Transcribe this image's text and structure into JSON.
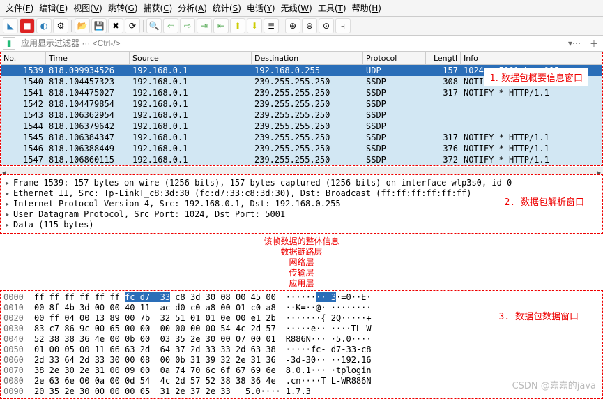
{
  "menubar": [
    "文件(F)",
    "编辑(E)",
    "视图(V)",
    "跳转(G)",
    "捕获(C)",
    "分析(A)",
    "统计(S)",
    "电话(Y)",
    "无线(W)",
    "工具(T)",
    "帮助(H)"
  ],
  "filter": {
    "placeholder": "应用显示过滤器 ··· <Ctrl-/>"
  },
  "columns": {
    "no": "No.",
    "time": "Time",
    "src": "Source",
    "dst": "Destination",
    "proto": "Protocol",
    "len": "Lengtl",
    "info": "Info"
  },
  "packets": [
    {
      "no": "1539",
      "time": "818.099934526",
      "src": "192.168.0.1",
      "dst": "192.168.0.255",
      "proto": "UDP",
      "len": "157",
      "info": "1024 → 5001 Len=115",
      "sel": true
    },
    {
      "no": "1540",
      "time": "818.104457323",
      "src": "192.168.0.1",
      "dst": "239.255.255.250",
      "proto": "SSDP",
      "len": "308",
      "info": "NOTIFY * HTTP/1.1"
    },
    {
      "no": "1541",
      "time": "818.104475027",
      "src": "192.168.0.1",
      "dst": "239.255.255.250",
      "proto": "SSDP",
      "len": "317",
      "info": "NOTIFY * HTTP/1.1"
    },
    {
      "no": "1542",
      "time": "818.104479854",
      "src": "192.168.0.1",
      "dst": "239.255.255.250",
      "proto": "SSDP",
      "len": "",
      "info": ""
    },
    {
      "no": "1543",
      "time": "818.106362954",
      "src": "192.168.0.1",
      "dst": "239.255.255.250",
      "proto": "SSDP",
      "len": "",
      "info": ""
    },
    {
      "no": "1544",
      "time": "818.106379642",
      "src": "192.168.0.1",
      "dst": "239.255.255.250",
      "proto": "SSDP",
      "len": "",
      "info": ""
    },
    {
      "no": "1545",
      "time": "818.106384347",
      "src": "192.168.0.1",
      "dst": "239.255.255.250",
      "proto": "SSDP",
      "len": "317",
      "info": "NOTIFY * HTTP/1.1"
    },
    {
      "no": "1546",
      "time": "818.106388449",
      "src": "192.168.0.1",
      "dst": "239.255.255.250",
      "proto": "SSDP",
      "len": "376",
      "info": "NOTIFY * HTTP/1.1"
    },
    {
      "no": "1547",
      "time": "818.106860115",
      "src": "192.168.0.1",
      "dst": "239.255.255.250",
      "proto": "SSDP",
      "len": "372",
      "info": "NOTIFY * HTTP/1.1"
    }
  ],
  "annos": {
    "a1": "1. 数据包概要信息窗口",
    "a2": "2. 数据包解析窗口",
    "a3": "3. 数据包数据窗口"
  },
  "details": [
    "Frame 1539: 157 bytes on wire (1256 bits), 157 bytes captured (1256 bits) on interface wlp3s0, id 0",
    "Ethernet II, Src: Tp-LinkT_c8:3d:30 (fc:d7:33:c8:3d:30), Dst: Broadcast (ff:ff:ff:ff:ff:ff)",
    "Internet Protocol Version 4, Src: 192.168.0.1, Dst: 192.168.0.255",
    "User Datagram Protocol, Src Port: 1024, Dst Port: 5001",
    "Data (115 bytes)"
  ],
  "layers": [
    "该帧数据的整体信息",
    "数据链路层",
    "网络层",
    "传输层",
    "应用层"
  ],
  "hex": [
    {
      "off": "0000",
      "h1": "ff ff ff ff ff ff ",
      "hl": "fc d7  33",
      "h2": " c8 3d 30 08 00 45 00",
      "a1": "······",
      "al": "·· 3",
      "a2": "·=0··E·"
    },
    {
      "off": "0010",
      "h1": "00 8f 4b 3d 00 00 40 11  ac d0 c0 a8 00 01 c0 a8",
      "a1": "··K=··@· ········"
    },
    {
      "off": "0020",
      "h1": "00 ff 04 00 13 89 00 7b  32 51 01 01 0e 00 e1 2b",
      "a1": "·······{ 2Q·····+"
    },
    {
      "off": "0030",
      "h1": "83 c7 86 9c 00 65 00 00  00 00 00 00 54 4c 2d 57",
      "a1": "·····e·· ····TL-W"
    },
    {
      "off": "0040",
      "h1": "52 38 38 36 4e 00 0b 00  03 35 2e 30 00 07 00 01",
      "a1": "R886N··· ·5.0····"
    },
    {
      "off": "0050",
      "h1": "01 00 05 00 11 66 63 2d  64 37 2d 33 33 2d 63 38",
      "a1": "·····fc- d7-33-c8"
    },
    {
      "off": "0060",
      "h1": "2d 33 64 2d 33 30 00 08  00 0b 31 39 32 2e 31 36",
      "a1": "-3d-30·· ··192.16"
    },
    {
      "off": "0070",
      "h1": "38 2e 30 2e 31 00 09 00  0a 74 70 6c 6f 67 69 6e",
      "a1": "8.0.1··· ·tplogin"
    },
    {
      "off": "0080",
      "h1": "2e 63 6e 00 0a 00 0d 54  4c 2d 57 52 38 38 36 4e",
      "a1": ".cn····T L-WR886N"
    },
    {
      "off": "0090",
      "h1": "20 35 2e 30 00 00 00 05  31 2e 37 2e 33",
      "a1": " 5.0···· 1.7.3"
    }
  ],
  "watermark": "CSDN @嘉嘉的java"
}
